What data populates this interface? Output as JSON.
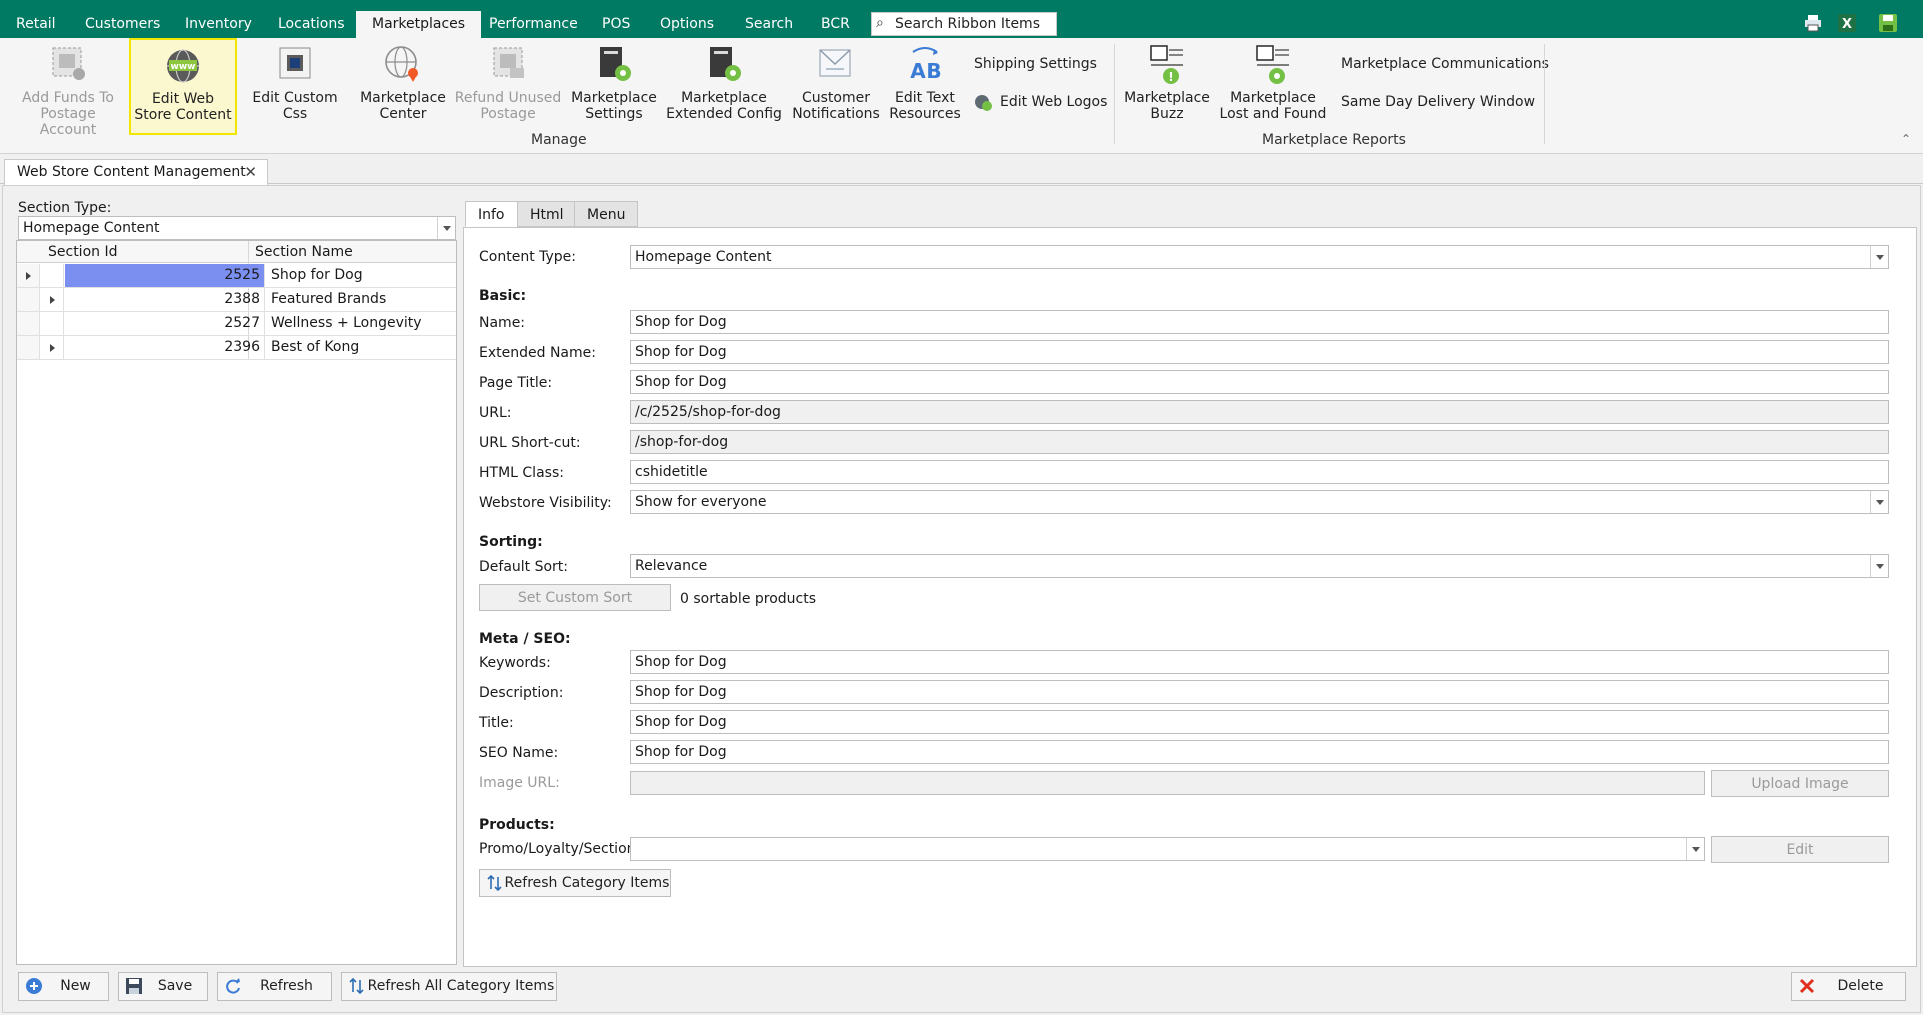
{
  "ribbon_tabs": [
    "Retail",
    "Customers",
    "Inventory",
    "Locations",
    "Marketplaces",
    "Performance",
    "POS",
    "Options",
    "Search",
    "BCR"
  ],
  "active_tab": "Marketplaces",
  "search": {
    "placeholder": "Search Ribbon Items"
  },
  "quick_access": {
    "print_icon": "printer-icon",
    "excel_icon": "excel-icon",
    "save_icon": "save-disk-icon"
  },
  "ribbon": {
    "manage_group": {
      "label": "Manage",
      "buttons": [
        {
          "line1": "Add Funds To",
          "line2": "Postage Account",
          "icon": "postage-funds-icon",
          "enabled": false
        },
        {
          "line1": "Edit Web",
          "line2": "Store Content",
          "icon": "www-globe-icon",
          "enabled": true,
          "highlighted": true
        },
        {
          "line1": "Edit Custom Css",
          "line2": "",
          "icon": "css-document-icon",
          "enabled": true
        },
        {
          "line1": "Marketplace",
          "line2": "Center",
          "icon": "globe-pin-icon",
          "enabled": true
        },
        {
          "line1": "Refund Unused",
          "line2": "Postage",
          "icon": "postage-refund-icon",
          "enabled": false
        },
        {
          "line1": "Marketplace",
          "line2": "Settings",
          "icon": "settings-gear-icon",
          "enabled": true
        },
        {
          "line1": "Marketplace",
          "line2": "Extended Config",
          "icon": "extended-config-icon",
          "enabled": true
        },
        {
          "line1": "Customer",
          "line2": "Notifications",
          "icon": "notifications-icon",
          "enabled": true
        },
        {
          "line1": "Edit Text",
          "line2": "Resources",
          "icon": "text-ab-icon",
          "enabled": true
        }
      ],
      "small_buttons": [
        {
          "label": "Shipping Settings"
        },
        {
          "label": "Edit Web Logos",
          "icon": "web-logos-icon"
        }
      ]
    },
    "reports_group": {
      "label": "Marketplace Reports",
      "buttons": [
        {
          "line1": "Marketplace",
          "line2": "Buzz",
          "icon": "buzz-report-icon"
        },
        {
          "line1": "Marketplace",
          "line2": "Lost and Found",
          "icon": "lost-found-report-icon"
        }
      ],
      "small_buttons": [
        {
          "label": "Marketplace Communications"
        },
        {
          "label": "Same Day Delivery Window"
        }
      ]
    }
  },
  "document_tab": {
    "title": "Web Store Content Management"
  },
  "left_panel": {
    "section_type_label": "Section Type:",
    "section_type_value": "Homepage Content",
    "columns": [
      "Section Id",
      "Section Name"
    ],
    "rows": [
      {
        "id": "2525",
        "name": "Shop for Dog",
        "expander": false,
        "selected": true
      },
      {
        "id": "2388",
        "name": "Featured Brands",
        "expander": true,
        "selected": false
      },
      {
        "id": "2527",
        "name": "Wellness + Longevity",
        "expander": false,
        "selected": false
      },
      {
        "id": "2396",
        "name": "Best of Kong",
        "expander": true,
        "selected": false
      }
    ]
  },
  "inner_tabs": [
    "Info",
    "Html",
    "Menu"
  ],
  "active_inner_tab": "Info",
  "form": {
    "content_type": {
      "label": "Content Type:",
      "value": "Homepage Content"
    },
    "basic_header": "Basic:",
    "name": {
      "label": "Name:",
      "value": "Shop for Dog"
    },
    "extended_name": {
      "label": "Extended Name:",
      "value": "Shop for Dog"
    },
    "page_title": {
      "label": "Page Title:",
      "value": "Shop for Dog"
    },
    "url": {
      "label": "URL:",
      "value": "/c/2525/shop-for-dog"
    },
    "url_shortcut": {
      "label": "URL Short-cut:",
      "value": "/shop-for-dog"
    },
    "html_class": {
      "label": "HTML Class:",
      "value": "cshidetitle"
    },
    "visibility": {
      "label": "Webstore Visibility:",
      "value": "Show for everyone"
    },
    "sorting_header": "Sorting:",
    "default_sort": {
      "label": "Default Sort:",
      "value": "Relevance"
    },
    "set_custom_sort": "Set Custom Sort",
    "sortable_count": "0 sortable products",
    "meta_header": "Meta / SEO:",
    "keywords": {
      "label": "Keywords:",
      "value": "Shop for Dog"
    },
    "description": {
      "label": "Description:",
      "value": "Shop for Dog"
    },
    "title": {
      "label": "Title:",
      "value": "Shop for Dog"
    },
    "seo_name": {
      "label": "SEO Name:",
      "value": "Shop for Dog"
    },
    "image_url": {
      "label": "Image URL:",
      "value": ""
    },
    "upload_image": "Upload Image",
    "products_header": "Products:",
    "promo": {
      "label": "Promo/Loyalty/Section:",
      "value": ""
    },
    "edit": "Edit",
    "refresh_category": "Refresh Category Items"
  },
  "bottom_buttons": {
    "new": "New",
    "save": "Save",
    "refresh": "Refresh",
    "refresh_all": "Refresh All Category Items",
    "delete": "Delete"
  },
  "colors": {
    "ribbon_green": "#007a63",
    "highlight_yellow": "#f2e600",
    "selected_row": "#7b8ff0"
  }
}
